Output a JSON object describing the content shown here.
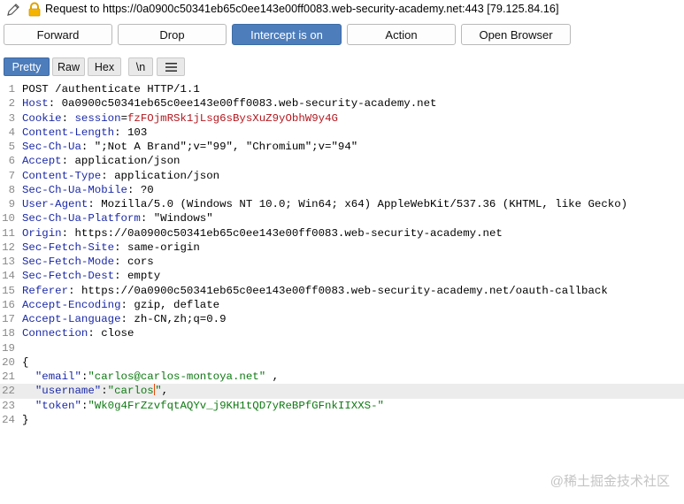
{
  "titlebar": {
    "title": "Request to https://0a0900c50341eb65c0ee143e00ff0083.web-security-academy.net:443  [79.125.84.16]"
  },
  "toolbar": {
    "buttons": [
      {
        "label": "Forward"
      },
      {
        "label": "Drop"
      },
      {
        "label": "Intercept is on",
        "active": true
      },
      {
        "label": "Action"
      },
      {
        "label": "Open Browser"
      }
    ]
  },
  "view_tabs": [
    {
      "label": "Pretty",
      "active": true
    },
    {
      "label": "Raw"
    },
    {
      "label": "Hex"
    },
    {
      "label": "\\n"
    }
  ],
  "menu_icon": "hamburger-menu-icon",
  "request": {
    "request_line": "POST /authenticate HTTP/1.1",
    "headers": [
      {
        "name": "Host",
        "value": "0a0900c50341eb65c0ee143e00ff0083.web-security-academy.net"
      },
      {
        "name": "Cookie",
        "value": "",
        "cookie_name": "session",
        "cookie_value": "fzFOjmRSk1jLsg6sBysXuZ9yObhW9y4G"
      },
      {
        "name": "Content-Length",
        "value": "103"
      },
      {
        "name": "Sec-Ch-Ua",
        "value": "\";Not A Brand\";v=\"99\", \"Chromium\";v=\"94\""
      },
      {
        "name": "Accept",
        "value": "application/json"
      },
      {
        "name": "Content-Type",
        "value": "application/json"
      },
      {
        "name": "Sec-Ch-Ua-Mobile",
        "value": "?0"
      },
      {
        "name": "User-Agent",
        "value": "Mozilla/5.0 (Windows NT 10.0; Win64; x64) AppleWebKit/537.36 (KHTML, like Gecko)"
      },
      {
        "name": "Sec-Ch-Ua-Platform",
        "value": "\"Windows\""
      },
      {
        "name": "Origin",
        "value": "https://0a0900c50341eb65c0ee143e00ff0083.web-security-academy.net"
      },
      {
        "name": "Sec-Fetch-Site",
        "value": "same-origin"
      },
      {
        "name": "Sec-Fetch-Mode",
        "value": "cors"
      },
      {
        "name": "Sec-Fetch-Dest",
        "value": "empty"
      },
      {
        "name": "Referer",
        "value": "https://0a0900c50341eb65c0ee143e00ff0083.web-security-academy.net/oauth-callback"
      },
      {
        "name": "Accept-Encoding",
        "value": "gzip, deflate"
      },
      {
        "name": "Accept-Language",
        "value": "zh-CN,zh;q=0.9"
      },
      {
        "name": "Connection",
        "value": "close"
      }
    ],
    "body_open": "{",
    "body": [
      {
        "key": "\"email\"",
        "value": "\"carlos@carlos-montoya.net\"",
        "suffix": " ,"
      },
      {
        "key": "\"username\"",
        "value": "\"carlos\"",
        "suffix": ",",
        "caret_before_last": true,
        "highlight": true
      },
      {
        "key": "\"token\"",
        "value": "\"Wk0g4FrZzvfqtAQYv_j9KH1tQD7yReBPfGFnkIIXXS-\"",
        "suffix": ""
      }
    ],
    "body_close": "}"
  },
  "watermark": "@稀土掘金技术社区"
}
